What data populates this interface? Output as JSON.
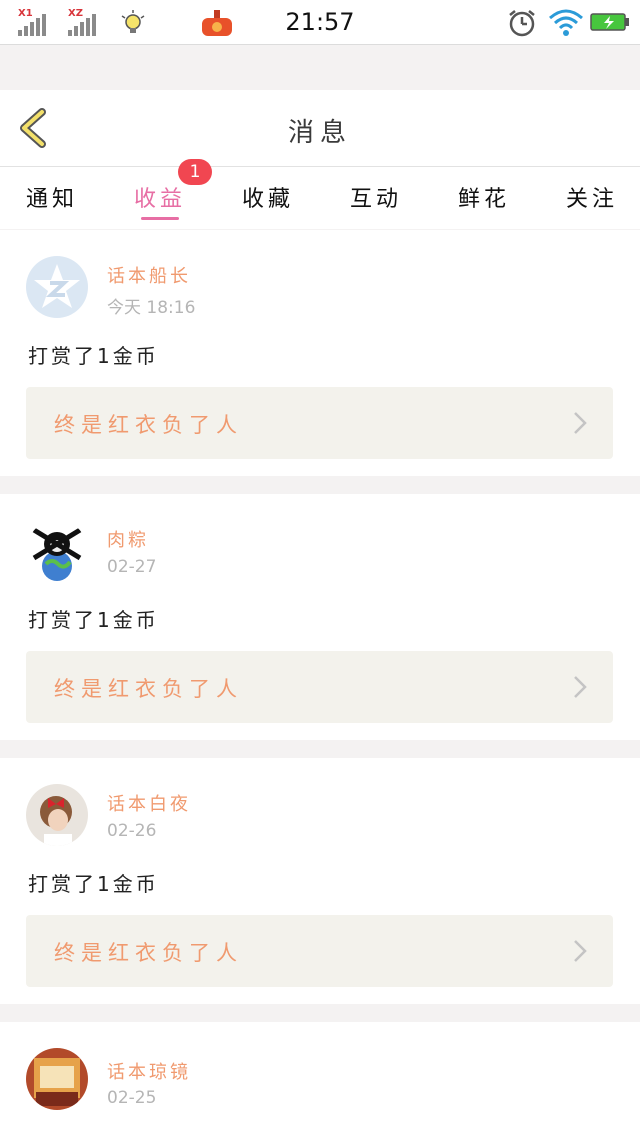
{
  "status_bar": {
    "sim1_label": "X1",
    "sim2_label": "XZ",
    "time": "21:57"
  },
  "header": {
    "title": "消息"
  },
  "tabs": [
    {
      "label": "通知",
      "active": false
    },
    {
      "label": "收益",
      "active": true,
      "badge": "1"
    },
    {
      "label": "收藏",
      "active": false
    },
    {
      "label": "互动",
      "active": false
    },
    {
      "label": "鲜花",
      "active": false
    },
    {
      "label": "关注",
      "active": false
    }
  ],
  "colors": {
    "accent": "#e76ea4",
    "name_color": "#f09a6f",
    "badge": "#f14651"
  },
  "messages": [
    {
      "name": "话本船长",
      "time": "今天 18:16",
      "action": "打赏了1金币",
      "work": "终是红衣负了人",
      "avatar": "qzone-logo"
    },
    {
      "name": "肉粽",
      "time": "02-27",
      "action": "打赏了1金币",
      "work": "终是红衣负了人",
      "avatar": "skull-globe"
    },
    {
      "name": "话本白夜",
      "time": "02-26",
      "action": "打赏了1金币",
      "work": "终是红衣负了人",
      "avatar": "girl-red-bow"
    },
    {
      "name": "话本琼镜",
      "time": "02-25",
      "action": "",
      "work": "",
      "avatar": "brown-sticker"
    }
  ]
}
